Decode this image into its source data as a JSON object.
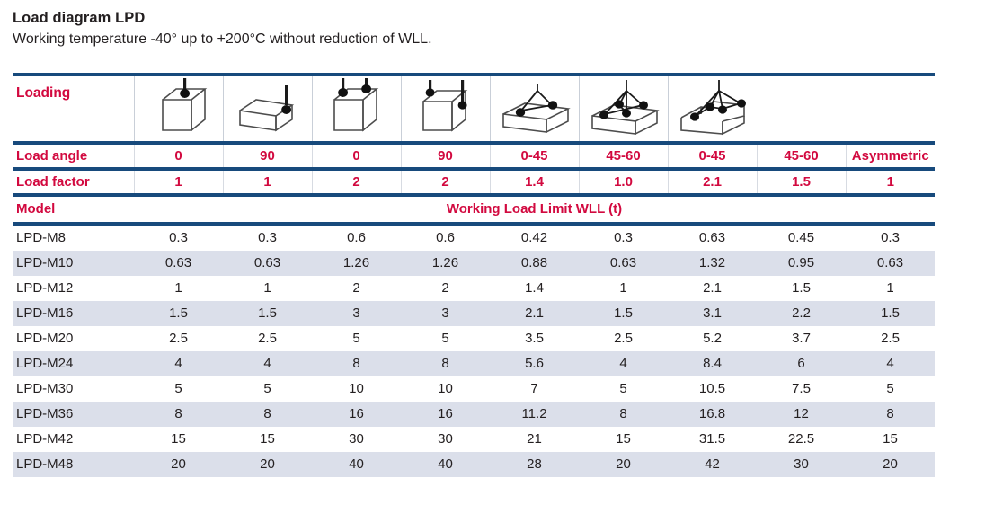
{
  "document": {
    "title": "Load diagram LPD",
    "subtitle": "Working temperature -40° up to +200°C without reduction of WLL."
  },
  "colors": {
    "accent_red": "#d2093f",
    "rule_blue": "#174a7c",
    "row_stripe": "#dbdfea",
    "text": "#231f20"
  },
  "table": {
    "loading_label": "Loading",
    "load_angle_label": "Load angle",
    "load_factor_label": "Load factor",
    "model_label": "Model",
    "wll_header": "Working Load Limit WLL (t)",
    "icons": [
      "single-leg-vertical-cube-icon",
      "single-leg-side-pull-flat-box-icon",
      "two-leg-vertical-cube-icon",
      "two-leg-side-pull-cube-icon",
      "two-leg-sling-flat-box-icon",
      "four-leg-sling-flat-box-icon",
      "asymmetric-sling-flat-box-icon"
    ],
    "load_angles": [
      "0",
      "90",
      "0",
      "90",
      "0-45",
      "45-60",
      "0-45",
      "45-60",
      "Asymmetric"
    ],
    "load_factors": [
      "1",
      "1",
      "2",
      "2",
      "1.4",
      "1.0",
      "2.1",
      "1.5",
      "1"
    ],
    "rows": [
      {
        "model": "LPD-M8",
        "values": [
          "0.3",
          "0.3",
          "0.6",
          "0.6",
          "0.42",
          "0.3",
          "0.63",
          "0.45",
          "0.3"
        ]
      },
      {
        "model": "LPD-M10",
        "values": [
          "0.63",
          "0.63",
          "1.26",
          "1.26",
          "0.88",
          "0.63",
          "1.32",
          "0.95",
          "0.63"
        ]
      },
      {
        "model": "LPD-M12",
        "values": [
          "1",
          "1",
          "2",
          "2",
          "1.4",
          "1",
          "2.1",
          "1.5",
          "1"
        ]
      },
      {
        "model": "LPD-M16",
        "values": [
          "1.5",
          "1.5",
          "3",
          "3",
          "2.1",
          "1.5",
          "3.1",
          "2.2",
          "1.5"
        ]
      },
      {
        "model": "LPD-M20",
        "values": [
          "2.5",
          "2.5",
          "5",
          "5",
          "3.5",
          "2.5",
          "5.2",
          "3.7",
          "2.5"
        ]
      },
      {
        "model": "LPD-M24",
        "values": [
          "4",
          "4",
          "8",
          "8",
          "5.6",
          "4",
          "8.4",
          "6",
          "4"
        ]
      },
      {
        "model": "LPD-M30",
        "values": [
          "5",
          "5",
          "10",
          "10",
          "7",
          "5",
          "10.5",
          "7.5",
          "5"
        ]
      },
      {
        "model": "LPD-M36",
        "values": [
          "8",
          "8",
          "16",
          "16",
          "11.2",
          "8",
          "16.8",
          "12",
          "8"
        ]
      },
      {
        "model": "LPD-M42",
        "values": [
          "15",
          "15",
          "30",
          "30",
          "21",
          "15",
          "31.5",
          "22.5",
          "15"
        ]
      },
      {
        "model": "LPD-M48",
        "values": [
          "20",
          "20",
          "40",
          "40",
          "28",
          "20",
          "42",
          "30",
          "20"
        ]
      }
    ]
  }
}
